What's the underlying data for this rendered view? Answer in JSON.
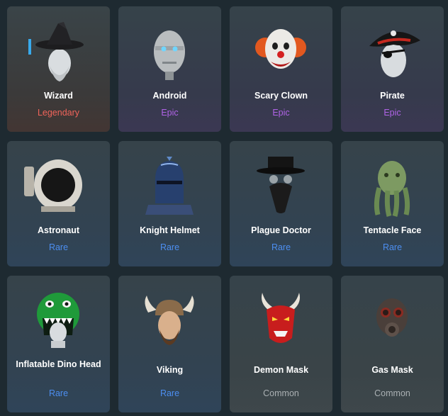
{
  "colors": {
    "Legendary": "#f0645a",
    "Epic": "#b063e6",
    "Rare": "#4c8ef0",
    "Common": "#aab0b3"
  },
  "items": [
    {
      "name": "Wizard",
      "rarity": "Legendary",
      "icon": "wizard-hat-icon"
    },
    {
      "name": "Android",
      "rarity": "Epic",
      "icon": "android-head-icon"
    },
    {
      "name": "Scary Clown",
      "rarity": "Epic",
      "icon": "clown-mask-icon"
    },
    {
      "name": "Pirate",
      "rarity": "Epic",
      "icon": "pirate-hat-icon"
    },
    {
      "name": "Astronaut",
      "rarity": "Rare",
      "icon": "astronaut-helmet-icon"
    },
    {
      "name": "Knight Helmet",
      "rarity": "Rare",
      "icon": "knight-helmet-icon"
    },
    {
      "name": "Plague Doctor",
      "rarity": "Rare",
      "icon": "plague-doctor-mask-icon"
    },
    {
      "name": "Tentacle Face",
      "rarity": "Rare",
      "icon": "tentacle-face-icon"
    },
    {
      "name": "Inflatable Dino Head",
      "rarity": "Rare",
      "icon": "dino-head-icon"
    },
    {
      "name": "Viking",
      "rarity": "Rare",
      "icon": "viking-helmet-icon"
    },
    {
      "name": "Demon Mask",
      "rarity": "Common",
      "icon": "demon-mask-icon"
    },
    {
      "name": "Gas Mask",
      "rarity": "Common",
      "icon": "gas-mask-icon"
    }
  ]
}
